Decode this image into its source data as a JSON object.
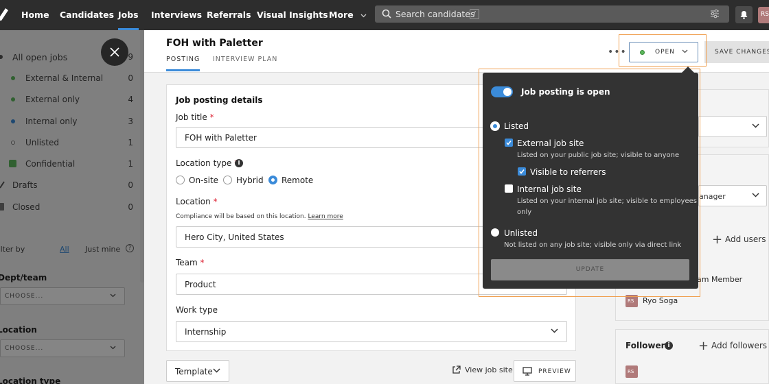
{
  "nav": {
    "items": [
      "Home",
      "Candidates",
      "Jobs",
      "Interviews",
      "Referrals",
      "Visual Insights",
      "More"
    ],
    "active": "Jobs",
    "search_placeholder": "Search candidates",
    "search_shortcut": "/",
    "avatar_initials": "RS"
  },
  "sidebar": {
    "all_open": {
      "label": "All open jobs",
      "count": "9"
    },
    "statuses": [
      {
        "label": "External & Internal",
        "count": "0"
      },
      {
        "label": "External only",
        "count": "4"
      },
      {
        "label": "Internal only",
        "count": "3"
      },
      {
        "label": "Unlisted",
        "count": "1"
      },
      {
        "label": "Confidential",
        "count": "1"
      }
    ],
    "drafts": {
      "label": "Drafts",
      "count": "0"
    },
    "closed": {
      "label": "Closed",
      "count": "0"
    },
    "filter_by": "Filter by",
    "filter_all": "All",
    "filter_mine": "Just mine",
    "filter_help": "?",
    "dept_label": "Dept/team",
    "dept_choose": "CHOOSE...",
    "location_label": "Location",
    "location_choose": "CHOOSE...",
    "location_type_label": "Location type"
  },
  "header": {
    "job_title": "FOH with Paletter",
    "tabs": [
      "POSTING",
      "INTERVIEW PLAN"
    ],
    "more": "•••",
    "status_button": "OPEN",
    "save_button": "SAVE CHANGES"
  },
  "form": {
    "card_title": "Job posting details",
    "job_title_label": "Job title",
    "job_title_value": "FOH with Paletter",
    "location_type_label": "Location type",
    "location_options": [
      "On-site",
      "Hybrid",
      "Remote"
    ],
    "location_selected": "Remote",
    "location_label": "Location",
    "compliance_note": "Compliance will be based on this location.",
    "learn_more": "Learn more",
    "location_value": "Hero City, United States",
    "team_label": "Team",
    "team_value": "Product",
    "work_type_label": "Work type",
    "work_type_value": "Internship",
    "required_mark": "*",
    "info_mark": "i"
  },
  "footer": {
    "template": "Template",
    "view_site": "View job site",
    "preview": "PREVIEW"
  },
  "right": {
    "hiring_manager_partial": "anager",
    "add_users": "Add users",
    "team_member_partial": "am Member",
    "user_initials": "RS",
    "user_name": "Ryo Soga",
    "followers_label": "Followers",
    "add_followers": "Add followers",
    "follower_initials": "RS",
    "info_mark": "i",
    "plus": "+"
  },
  "popover": {
    "title": "Job posting is open",
    "listed": "Listed",
    "external": "External job site",
    "external_desc": "Listed on your public job site; visible to anyone",
    "referrers": "Visible to referrers",
    "internal": "Internal job site",
    "internal_desc_1": "Listed on your internal job site; visible to employees",
    "internal_desc_2": "only",
    "unlisted": "Unlisted",
    "unlisted_desc": "Not listed on any job site; visible only via direct link",
    "update": "UPDATE"
  },
  "colors": {
    "accent": "#3b8bd9",
    "nav_bg": "#2d2d2d",
    "highlight": "#f0a050",
    "open_green": "#5cb85c"
  }
}
